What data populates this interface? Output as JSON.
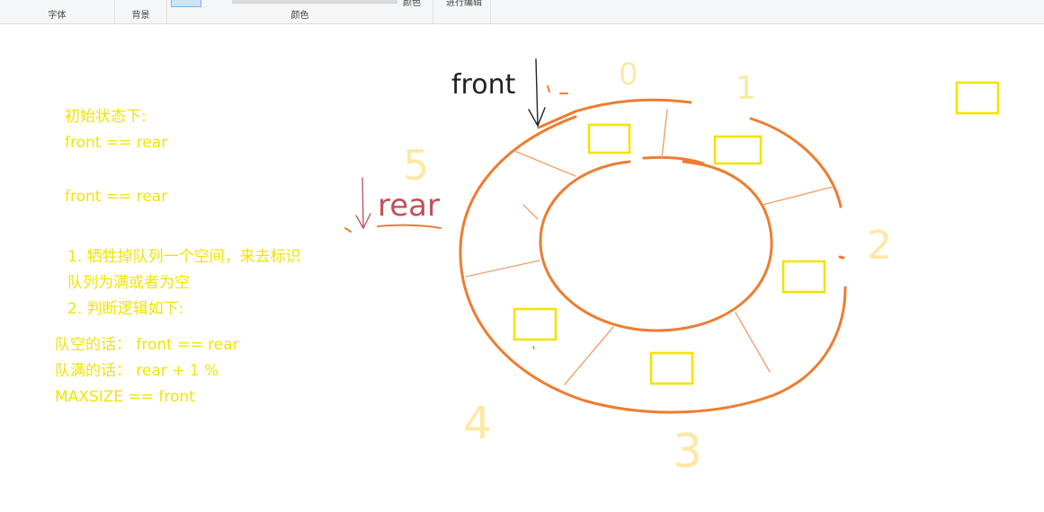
{
  "ribbon": {
    "groups": {
      "font": "字体",
      "background": "背景",
      "color": "颜色"
    },
    "partial_items": {
      "color_partial": "颜色",
      "edit_partial": "进行编辑"
    }
  },
  "canvas": {
    "notes": {
      "line1": "初始状态下:",
      "line2": "front == rear",
      "line3": "front == rear",
      "line4": "1. 牺牲掉队列一个空间，来去标识",
      "line5": "队列为满或者为空",
      "line6": "2. 判断逻辑如下:",
      "line7": "队空的话： front == rear",
      "line8": "队满的话： rear + 1 %",
      "line9": "MAXSIZE == front"
    },
    "handwriting": {
      "front": "front",
      "rear": "rear",
      "idx0": "0",
      "idx1": "1",
      "idx2": "2",
      "idx3": "3",
      "idx4": "4",
      "idx5": "5"
    },
    "colors": {
      "note_text": "#f2e400",
      "ring": "#ed7d31",
      "slot_box": "#f2e400",
      "index_digits": "#fbe9a6",
      "front_label": "#222222",
      "rear_label": "#c0505a"
    }
  }
}
